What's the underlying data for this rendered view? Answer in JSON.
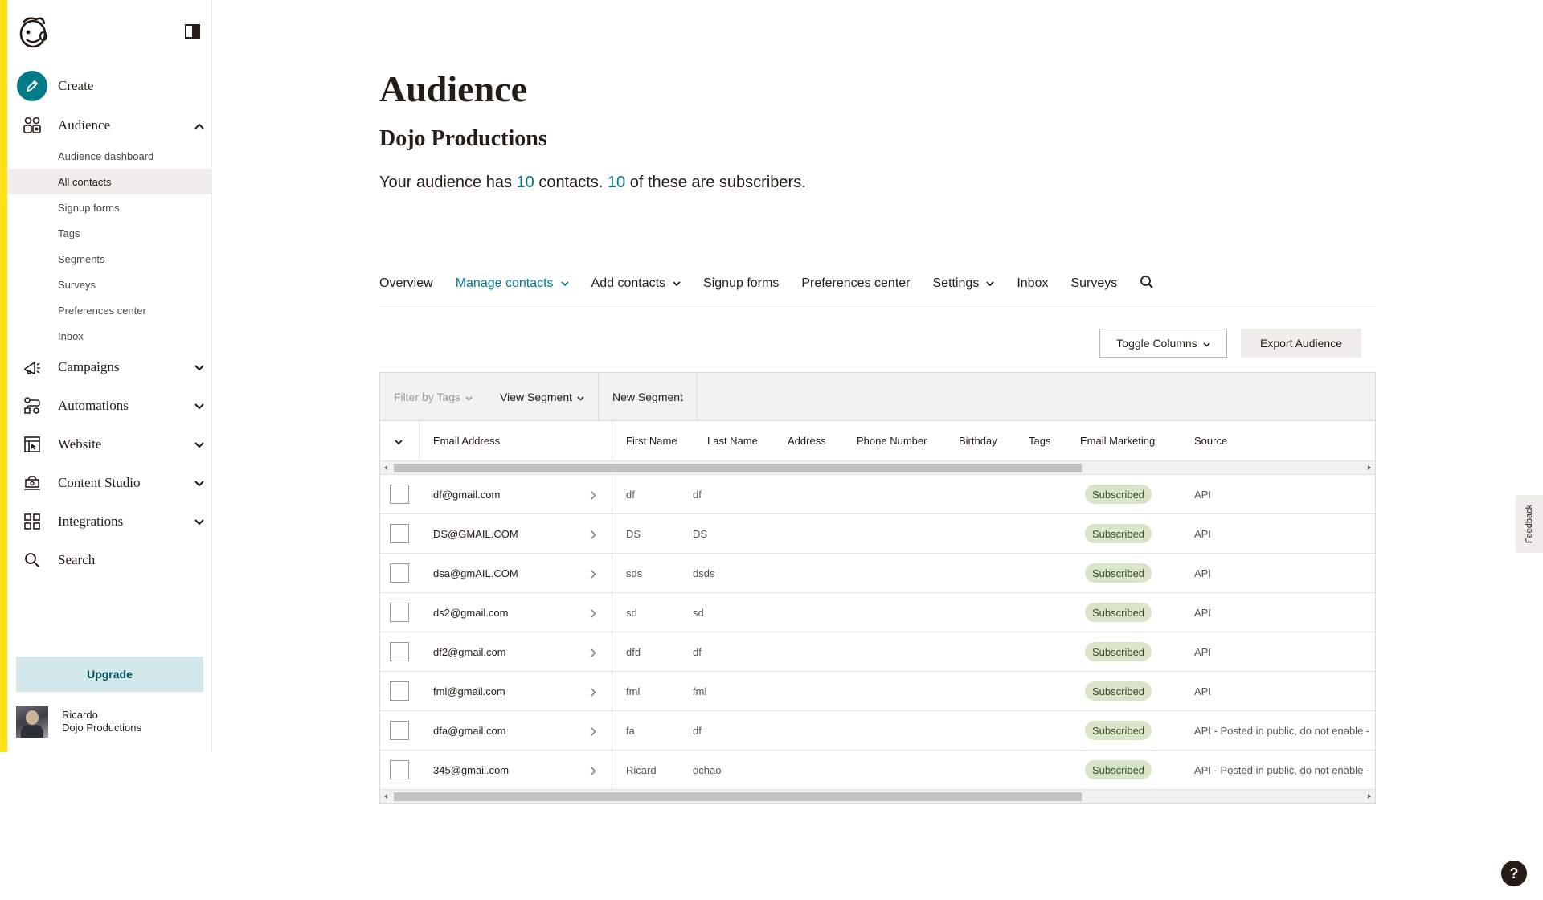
{
  "sidebar": {
    "items": {
      "create": "Create",
      "audience": "Audience",
      "campaigns": "Campaigns",
      "automations": "Automations",
      "website": "Website",
      "content_studio": "Content Studio",
      "integrations": "Integrations",
      "search": "Search"
    },
    "audience_sub": {
      "dashboard": "Audience dashboard",
      "all_contacts": "All contacts",
      "signup_forms": "Signup forms",
      "tags": "Tags",
      "segments": "Segments",
      "surveys": "Surveys",
      "preferences_center": "Preferences center",
      "inbox": "Inbox"
    },
    "upgrade_label": "Upgrade",
    "user": {
      "name": "Ricardo",
      "org": "Dojo Productions"
    },
    "active_item": "All contacts"
  },
  "header": {
    "title": "Audience",
    "audience_name": "Dojo Productions",
    "summary": {
      "prefix": "Your audience has",
      "contacts": "10",
      "middle": "contacts.",
      "subscribers": "10",
      "suffix": "of these are subscribers."
    }
  },
  "tabs": {
    "overview": "Overview",
    "manage_contacts": "Manage contacts",
    "add_contacts": "Add contacts",
    "signup_forms": "Signup forms",
    "preferences_center": "Preferences center",
    "settings": "Settings",
    "inbox": "Inbox",
    "surveys": "Surveys",
    "active": "Manage contacts"
  },
  "actions": {
    "toggle_columns": "Toggle Columns",
    "export": "Export Audience"
  },
  "toolbar": {
    "filter_tags": "Filter by Tags",
    "view_segment": "View Segment",
    "new_segment": "New Segment"
  },
  "table": {
    "columns": {
      "email": "Email Address",
      "first_name": "First Name",
      "last_name": "Last Name",
      "address": "Address",
      "phone": "Phone Number",
      "birthday": "Birthday",
      "tags": "Tags",
      "email_marketing": "Email Marketing",
      "source": "Source"
    },
    "rows": [
      {
        "email": "df@gmail.com",
        "first": "df",
        "last": "df",
        "status": "Subscribed",
        "source": "API"
      },
      {
        "email": "DS@GMAIL.COM",
        "first": "DS",
        "last": "DS",
        "status": "Subscribed",
        "source": "API"
      },
      {
        "email": "dsa@gmAIL.COM",
        "first": "sds",
        "last": "dsds",
        "status": "Subscribed",
        "source": "API"
      },
      {
        "email": "ds2@gmail.com",
        "first": "sd",
        "last": "sd",
        "status": "Subscribed",
        "source": "API"
      },
      {
        "email": "df2@gmail.com",
        "first": "dfd",
        "last": "df",
        "status": "Subscribed",
        "source": "API"
      },
      {
        "email": "fml@gmail.com",
        "first": "fml",
        "last": "fml",
        "status": "Subscribed",
        "source": "API"
      },
      {
        "email": "dfa@gmail.com",
        "first": "fa",
        "last": "df",
        "status": "Subscribed",
        "source": "API - Posted in public, do not enable -"
      },
      {
        "email": "345@gmail.com",
        "first": "Ricard",
        "last": "ochao",
        "status": "Subscribed",
        "source": "API - Posted in public, do not enable -"
      }
    ]
  },
  "feedback_label": "Feedback",
  "help_label": "?",
  "colors": {
    "accent": "#007c89",
    "brand_yellow": "#ffe01b",
    "badge_bg": "#d8e5c8",
    "upgrade_bg": "#d2e8ea"
  }
}
